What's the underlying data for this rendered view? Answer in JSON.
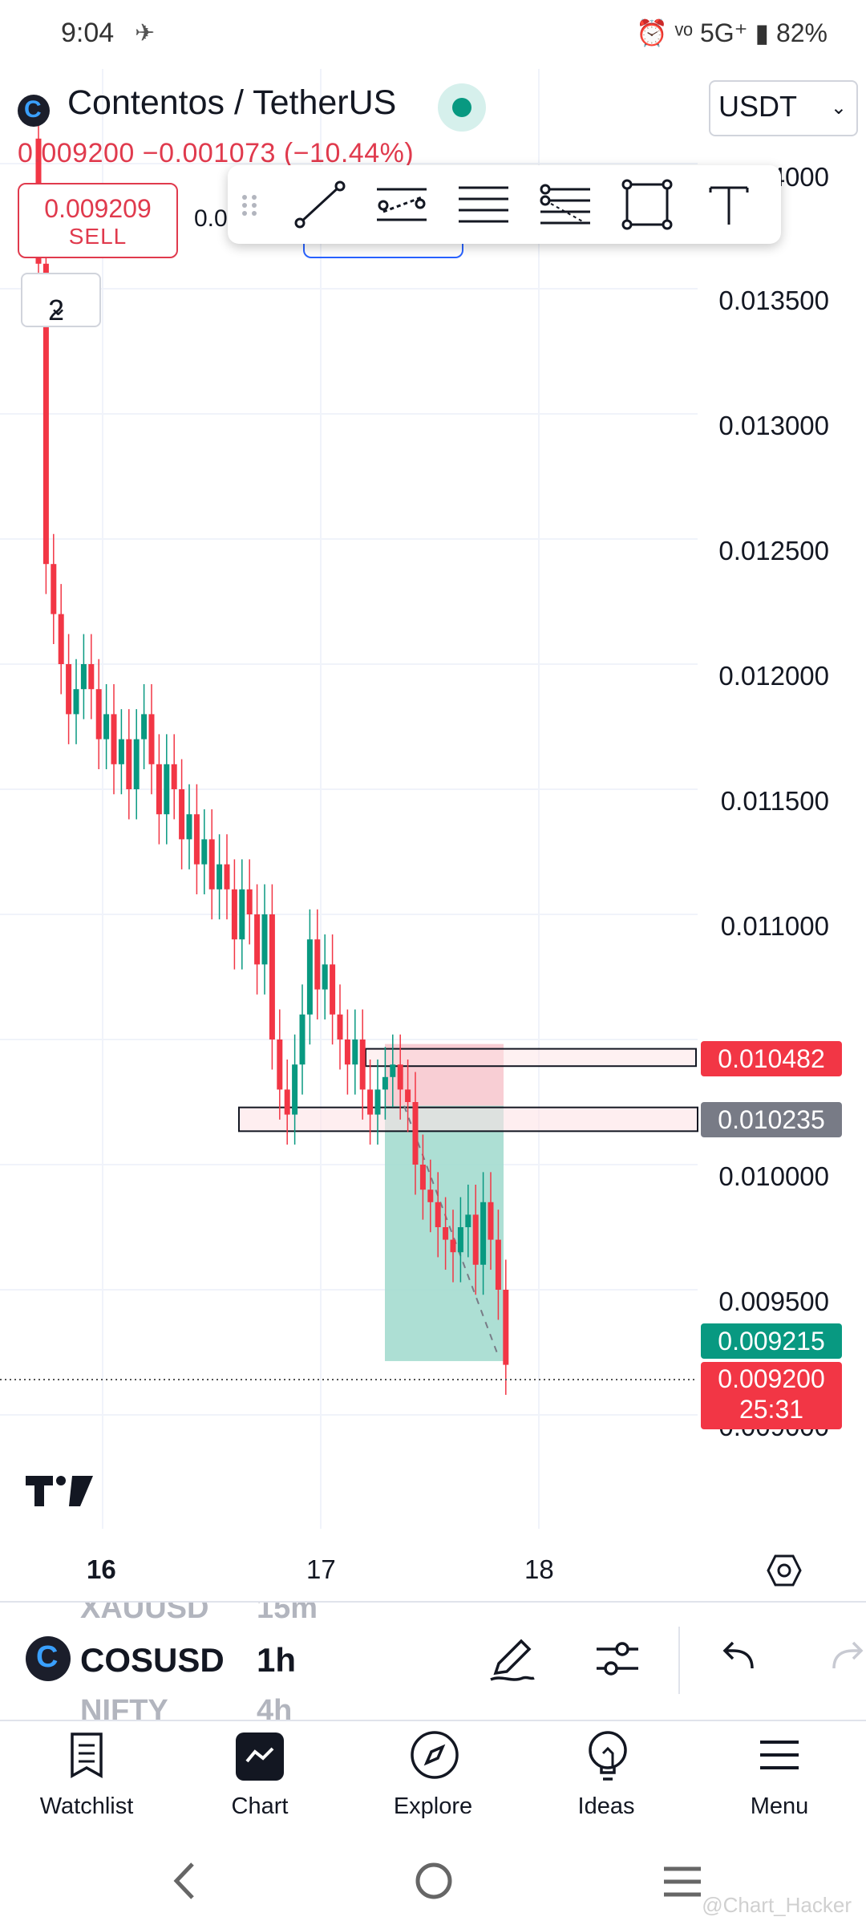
{
  "status_bar": {
    "time": "9:04",
    "right": "⏰ ᵛᵒ 5G⁺ ▮ 82%"
  },
  "header": {
    "symbol_title": "Contentos / TetherUS",
    "price_line": "0.009200  −0.001073 (−10.44%)",
    "currency": "USDT",
    "sell_price": "0.009209",
    "sell_label": "SELL",
    "buy_price_cut": "0.00",
    "indicator_count": "2"
  },
  "drawing_toolbar": {
    "tools": [
      "trend-line-icon",
      "parallel-channel-icon",
      "horizontal-lines-icon",
      "fib-retracement-icon",
      "rectangle-icon",
      "text-icon"
    ]
  },
  "chart_data": {
    "type": "candlestick",
    "yaxis": {
      "ticks": [
        "0.014000",
        "0.013500",
        "0.013000",
        "0.012500",
        "0.012000",
        "0.011500",
        "0.011000",
        "0.010000",
        "0.009500",
        "0.009000"
      ]
    },
    "xaxis": {
      "ticks": [
        "16",
        "17",
        "18"
      ]
    },
    "price_labels": [
      {
        "value": "0.010482",
        "color": "#f23645"
      },
      {
        "value": "0.010235",
        "color": "#787b86"
      },
      {
        "value": "0.009215",
        "color": "#089981"
      },
      {
        "value": "0.009200",
        "sub": "25:31",
        "color": "#f23645"
      }
    ],
    "zones": [
      {
        "name": "resistance",
        "from": 0.0104,
        "to": 0.010482
      },
      {
        "name": "support",
        "from": 0.01014,
        "to": 0.010235
      }
    ],
    "position": {
      "entry": 0.010235,
      "stop": 0.010482,
      "target": 0.009215
    },
    "colors": {
      "up": "#089981",
      "down": "#f23645"
    }
  },
  "symbol_bar": {
    "prev_symbol": "XAUUSD",
    "prev_tf": "15m",
    "symbol": "COSUSD",
    "timeframe": "1h",
    "next_symbol": "NIFTY",
    "next_tf": "4h"
  },
  "bottom_nav": [
    {
      "label": "Watchlist",
      "icon": "watchlist-icon"
    },
    {
      "label": "Chart",
      "icon": "chart-icon"
    },
    {
      "label": "Explore",
      "icon": "compass-icon"
    },
    {
      "label": "Ideas",
      "icon": "lightbulb-icon"
    },
    {
      "label": "Menu",
      "icon": "menu-icon"
    }
  ],
  "watermark": "@Chart_Hacker"
}
